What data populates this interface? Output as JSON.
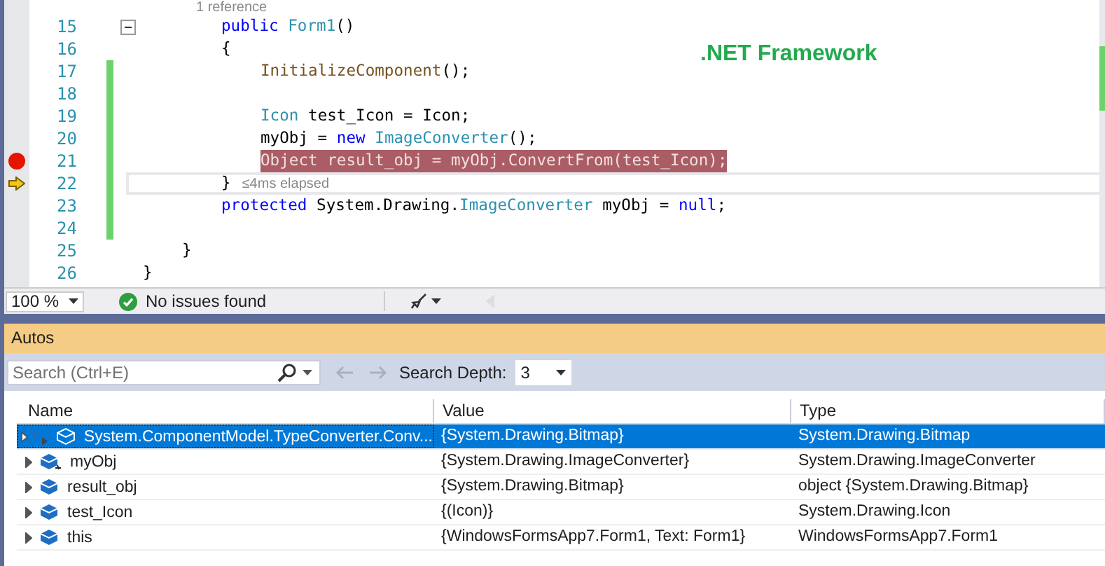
{
  "editor": {
    "codelens": "1 reference",
    "annotation": ".NET Framework",
    "lines": [
      {
        "children": [
          {
            "children": [
              {
                "number": "15",
                "collapsible": true,
                "changed": false,
                "breakpoint": false,
                "current": false,
                "tokens": [
                  {
                    "kind": "kw",
                    "text": "public "
                  },
                  {
                    "kind": "type",
                    "text": "Form1"
                  },
                  {
                    "kind": "plain",
                    "text": "()"
                  }
                ]
              },
              {
                "number": "16",
                "collapsible": false,
                "changed": false,
                "breakpoint": false,
                "current": false,
                "tokens": [
                  {
                    "kind": "plain",
                    "text": "{"
                  }
                ]
              },
              {
                "children": [
                  {
                    "number": "17",
                    "collapsible": false,
                    "changed": true,
                    "breakpoint": false,
                    "current": false,
                    "tokens": [
                      {
                        "kind": "method",
                        "text": "InitializeComponent"
                      },
                      {
                        "kind": "plain",
                        "text": "();"
                      }
                    ]
                  },
                  {
                    "number": "18",
                    "collapsible": false,
                    "changed": true,
                    "breakpoint": false,
                    "current": false
                  },
                  {
                    "number": "19",
                    "collapsible": false,
                    "changed": true,
                    "breakpoint": false,
                    "current": false,
                    "tokens": [
                      {
                        "kind": "type",
                        "text": "Icon"
                      },
                      {
                        "kind": "plain",
                        "text": " test_Icon = Icon;"
                      }
                    ]
                  },
                  {
                    "number": "20",
                    "collapsible": false,
                    "changed": true,
                    "breakpoint": false,
                    "current": false,
                    "tokens": [
                      {
                        "kind": "plain",
                        "text": "myObj = "
                      },
                      {
                        "kind": "kw",
                        "text": "new "
                      },
                      {
                        "kind": "type",
                        "text": "ImageConverter"
                      },
                      {
                        "kind": "plain",
                        "text": "();"
                      }
                    ]
                  },
                  {
                    "number": "21",
                    "collapsible": false,
                    "changed": true,
                    "breakpoint": true,
                    "current": false,
                    "tokens": [
                      {
                        "kind": "plain",
                        "text": "Object result_obj = myObj.ConvertFrom(test_Icon);"
                      }
                    ]
                  }
                ]
              },
              {
                "number": "22",
                "collapsible": false,
                "changed": true,
                "breakpoint": false,
                "current": true,
                "tokens": [
                  {
                    "kind": "plain",
                    "text": "}"
                  }
                ],
                "perf_tip": "≤4ms elapsed"
              },
              {
                "number": "23",
                "collapsible": false,
                "changed": true,
                "breakpoint": false,
                "current": false,
                "tokens": [
                  {
                    "kind": "kw",
                    "text": "protected "
                  },
                  {
                    "kind": "plain",
                    "text": "System.Drawing."
                  },
                  {
                    "kind": "type",
                    "text": "ImageConverter"
                  },
                  {
                    "kind": "plain",
                    "text": " myObj = "
                  },
                  {
                    "kind": "kw",
                    "text": "null"
                  },
                  {
                    "kind": "plain",
                    "text": ";"
                  }
                ]
              },
              {
                "number": "24",
                "collapsible": false,
                "changed": true,
                "breakpoint": false,
                "current": false
              }
            ]
          },
          {
            "number": "25",
            "collapsible": false,
            "changed": false,
            "breakpoint": false,
            "current": false,
            "tokens": [
              {
                "kind": "plain",
                "text": "}"
              }
            ]
          }
        ]
      },
      {
        "number": "26",
        "collapsible": false,
        "changed": false,
        "breakpoint": false,
        "current": false,
        "tokens": [
          {
            "kind": "plain",
            "text": "}"
          }
        ]
      }
    ]
  },
  "status_bar": {
    "zoom": "100 %",
    "issues": "No issues found"
  },
  "autos": {
    "title": "Autos",
    "search": {
      "placeholder": "Search (Ctrl+E)"
    },
    "search_depth_label": "Search Depth:",
    "search_depth": "3",
    "columns": [
      "Name",
      "Value",
      "Type"
    ],
    "rows": [
      {
        "kind": "return",
        "selected": true,
        "name": "System.ComponentModel.TypeConverter.Conv...",
        "value": "{System.Drawing.Bitmap}",
        "type": "System.Drawing.Bitmap"
      },
      {
        "kind": "field",
        "selected": false,
        "name": "myObj",
        "value": "{System.Drawing.ImageConverter}",
        "type": "System.Drawing.ImageConverter"
      },
      {
        "kind": "local",
        "selected": false,
        "name": "result_obj",
        "value": "{System.Drawing.Bitmap}",
        "type": "object {System.Drawing.Bitmap}"
      },
      {
        "kind": "local",
        "selected": false,
        "name": "test_Icon",
        "value": "{(Icon)}",
        "type": "System.Drawing.Icon"
      },
      {
        "kind": "local",
        "selected": false,
        "name": "this",
        "value": "{WindowsFormsApp7.Form1, Text: Form1}",
        "type": "WindowsFormsApp7.Form1"
      }
    ]
  }
}
